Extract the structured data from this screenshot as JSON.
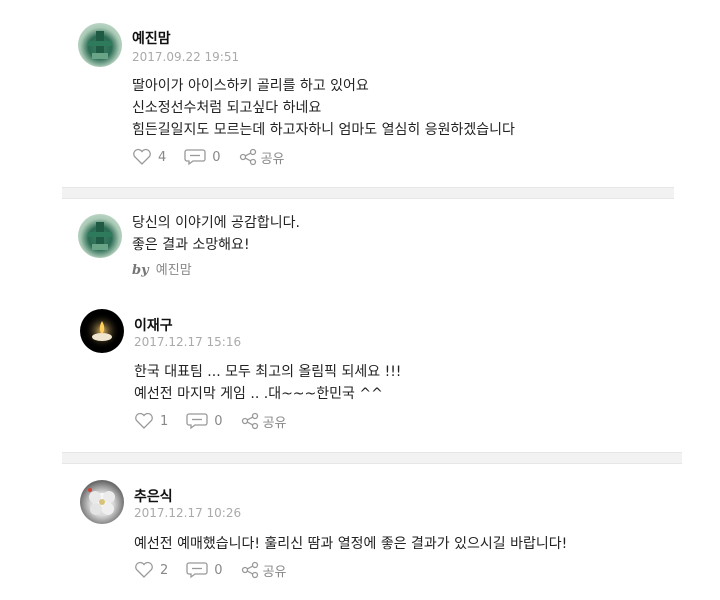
{
  "comments": [
    {
      "author": "예진맘",
      "date": "2017.09.22 19:51",
      "lines": [
        "딸아이가 아이스하키 골리를 하고 있어요",
        "신소정선수처럼 되고싶다 하네요",
        "힘든길일지도 모르는데 하고자하니 엄마도 열심히 응원하겠습니다"
      ],
      "likes": "4",
      "replies": "0",
      "share_label": "공유"
    },
    {
      "author": "이재구",
      "date": "2017.12.17 15:16",
      "lines": [
        "한국 대표팀 ... 모두 최고의 올림픽 되세요 !!!",
        "예선전 마지막 게임 .. .대~~~한민국 ^^"
      ],
      "likes": "1",
      "replies": "0",
      "share_label": "공유"
    },
    {
      "author": "추은식",
      "date": "2017.12.17 10:26",
      "lines": [
        "예선전 예매했습니다! 훌리신 땀과 열정에 좋은 결과가 있으시길 바랍니다!"
      ],
      "likes": "2",
      "replies": "0",
      "share_label": "공유"
    }
  ],
  "author_reply": {
    "lines": [
      "당신의 이야기에 공감합니다.",
      "좋은 결과 소망해요!"
    ],
    "by_label": "by",
    "by_name": "예진맘"
  },
  "icons": {
    "like": "heart-icon",
    "reply": "comment-bubble-icon",
    "share": "share-icon"
  }
}
